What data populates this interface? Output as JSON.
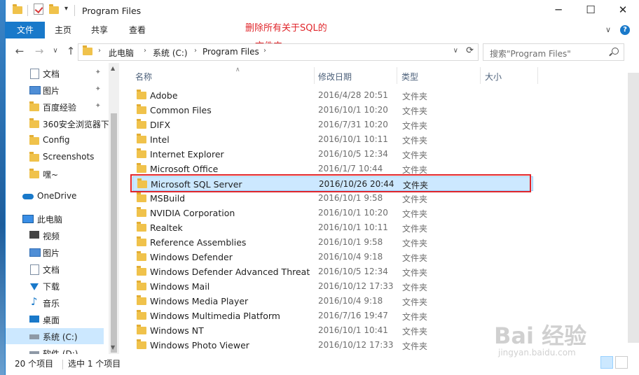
{
  "window": {
    "title": "Program Files",
    "controls": {
      "minimize": "─",
      "maximize": "☐",
      "close": "✕"
    }
  },
  "ribbon": {
    "tabs": [
      "文件",
      "主页",
      "共享",
      "查看"
    ],
    "expand_glyph": "∨",
    "help_glyph": "?"
  },
  "annotation": {
    "line1": "删除所有关于SQL的",
    "line2": "文件夹"
  },
  "nav": {
    "back": "←",
    "forward": "→",
    "recent": "∨",
    "up": "↑",
    "breadcrumb": [
      "此电脑",
      "系统 (C:)",
      "Program Files"
    ],
    "crumb_separator": "›",
    "refresh_glyph": "⟳",
    "search_placeholder": "搜索\"Program Files\""
  },
  "sidebar": {
    "items": [
      {
        "label": "文档",
        "icon": "document-icon",
        "pinned": true
      },
      {
        "label": "图片",
        "icon": "pictures-icon",
        "pinned": true
      },
      {
        "label": "百度经验",
        "icon": "folder-icon",
        "pinned": true
      },
      {
        "label": "360安全浏览器下",
        "icon": "folder-icon",
        "pinned": false
      },
      {
        "label": "Config",
        "icon": "folder-icon",
        "pinned": false
      },
      {
        "label": "Screenshots",
        "icon": "folder-icon",
        "pinned": false
      },
      {
        "label": "嘿~",
        "icon": "folder-icon",
        "pinned": false
      },
      {
        "label": "OneDrive",
        "icon": "cloud-icon",
        "pinned": false
      },
      {
        "label": "此电脑",
        "icon": "computer-icon",
        "pinned": false
      },
      {
        "label": "视频",
        "icon": "video-icon",
        "pinned": false
      },
      {
        "label": "图片",
        "icon": "pictures-icon",
        "pinned": false
      },
      {
        "label": "文档",
        "icon": "document-icon",
        "pinned": false
      },
      {
        "label": "下载",
        "icon": "download-icon",
        "pinned": false
      },
      {
        "label": "音乐",
        "icon": "music-icon",
        "pinned": false
      },
      {
        "label": "桌面",
        "icon": "desktop-icon",
        "pinned": false
      },
      {
        "label": "系统 (C:)",
        "icon": "drive-icon",
        "pinned": false,
        "selected": true
      },
      {
        "label": "软件 (D:)",
        "icon": "drive-icon",
        "pinned": false
      }
    ],
    "pin_glyph": "📌"
  },
  "columns": {
    "name": "名称",
    "date": "修改日期",
    "type": "类型",
    "size": "大小"
  },
  "files": [
    {
      "name": "Adobe",
      "date": "2016/4/28 20:51",
      "type": "文件夹"
    },
    {
      "name": "Common Files",
      "date": "2016/10/1 10:20",
      "type": "文件夹"
    },
    {
      "name": "DIFX",
      "date": "2016/7/31 10:20",
      "type": "文件夹"
    },
    {
      "name": "Intel",
      "date": "2016/10/1 10:11",
      "type": "文件夹"
    },
    {
      "name": "Internet Explorer",
      "date": "2016/10/5 12:34",
      "type": "文件夹"
    },
    {
      "name": "Microsoft Office",
      "date": "2016/1/7 10:44",
      "type": "文件夹"
    },
    {
      "name": "Microsoft SQL Server",
      "date": "2016/10/26 20:44",
      "type": "文件夹",
      "selected": true
    },
    {
      "name": "MSBuild",
      "date": "2016/10/1 9:58",
      "type": "文件夹"
    },
    {
      "name": "NVIDIA Corporation",
      "date": "2016/10/1 10:20",
      "type": "文件夹"
    },
    {
      "name": "Realtek",
      "date": "2016/10/1 10:11",
      "type": "文件夹"
    },
    {
      "name": "Reference Assemblies",
      "date": "2016/10/1 9:58",
      "type": "文件夹"
    },
    {
      "name": "Windows Defender",
      "date": "2016/10/4 9:18",
      "type": "文件夹"
    },
    {
      "name": "Windows Defender Advanced Threat ...",
      "date": "2016/10/5 12:34",
      "type": "文件夹"
    },
    {
      "name": "Windows Mail",
      "date": "2016/10/12 17:33",
      "type": "文件夹"
    },
    {
      "name": "Windows Media Player",
      "date": "2016/10/4 9:18",
      "type": "文件夹"
    },
    {
      "name": "Windows Multimedia Platform",
      "date": "2016/7/16 19:47",
      "type": "文件夹"
    },
    {
      "name": "Windows NT",
      "date": "2016/10/1 10:41",
      "type": "文件夹"
    },
    {
      "name": "Windows Photo Viewer",
      "date": "2016/10/12 17:33",
      "type": "文件夹"
    }
  ],
  "status": {
    "count": "20 个项目",
    "selection": "选中 1 个项目"
  },
  "watermark": {
    "main": "Bai 经验",
    "sub": "jingyan.baidu.com"
  }
}
